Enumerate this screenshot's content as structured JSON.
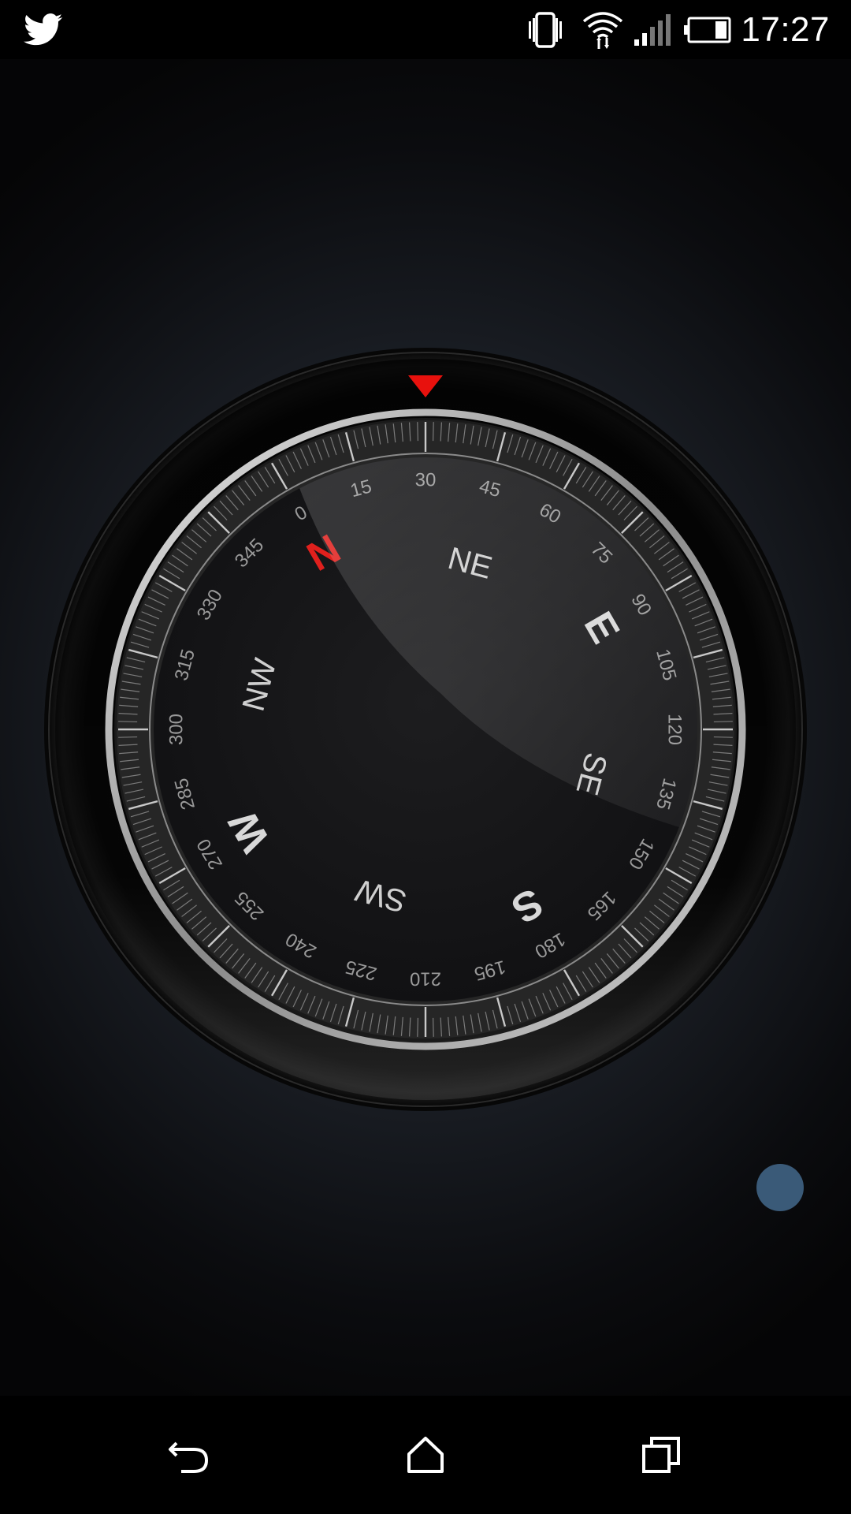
{
  "status_bar": {
    "time": "17:27",
    "icons": [
      "twitter-icon",
      "vibrate-icon",
      "wifi-icon",
      "cell-signal-icon",
      "battery-icon"
    ]
  },
  "compass": {
    "cardinals": [
      "N",
      "E",
      "S",
      "W"
    ],
    "intercardinals": [
      "NE",
      "SE",
      "SW",
      "NW"
    ],
    "degree_labels": [
      "0",
      "15",
      "30",
      "45",
      "60",
      "75",
      "90",
      "105",
      "120",
      "135",
      "150",
      "165",
      "180",
      "195",
      "210",
      "225",
      "240",
      "255",
      "270",
      "285",
      "300",
      "315",
      "330",
      "345"
    ],
    "heading_degrees": -30,
    "north_color": "#e0201d",
    "marker_color": "#e8110d"
  },
  "nav_bar": {
    "icons": [
      "back-icon",
      "home-icon",
      "recents-icon"
    ]
  },
  "accent_color": "#3a5a78"
}
